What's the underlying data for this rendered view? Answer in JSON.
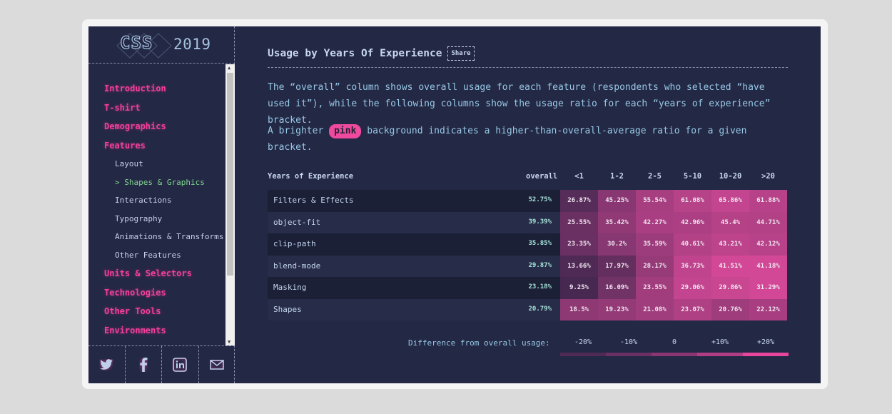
{
  "logo": {
    "mark": "CSS",
    "year": "2019"
  },
  "nav": [
    {
      "label": "Introduction",
      "level": "top"
    },
    {
      "label": "T-shirt",
      "level": "top"
    },
    {
      "label": "Demographics",
      "level": "top"
    },
    {
      "label": "Features",
      "level": "top"
    },
    {
      "label": "Layout",
      "level": "sub"
    },
    {
      "label": "> Shapes & Graphics",
      "level": "sub",
      "active": true
    },
    {
      "label": "Interactions",
      "level": "sub"
    },
    {
      "label": "Typography",
      "level": "sub"
    },
    {
      "label": "Animations & Transforms",
      "level": "sub"
    },
    {
      "label": "Other Features",
      "level": "sub"
    },
    {
      "label": "Units & Selectors",
      "level": "top"
    },
    {
      "label": "Technologies",
      "level": "top"
    },
    {
      "label": "Other Tools",
      "level": "top"
    },
    {
      "label": "Environments",
      "level": "top"
    }
  ],
  "social": [
    "twitter-icon",
    "facebook-icon",
    "linkedin-icon",
    "mail-icon"
  ],
  "section": {
    "title": "Usage by Years Of Experience",
    "share_label": "Share",
    "description_1": "The “overall” column shows overall usage for each feature (respondents who selected “have used it”), while the following columns show the usage ratio for each “years of experience” bracket.",
    "description_2_before": "A brighter",
    "description_2_pill": "pink",
    "description_2_after": "background indicates a higher-than-overall-average ratio for a given bracket."
  },
  "table": {
    "header_feature": "Years of Experience",
    "header_overall": "overall",
    "brackets": [
      "<1",
      "1-2",
      "2-5",
      "5-10",
      "10-20",
      ">20"
    ],
    "rows": [
      {
        "feature": "Filters & Effects",
        "overall": "52.75%",
        "values": [
          "26.87%",
          "45.25%",
          "55.54%",
          "61.08%",
          "65.86%",
          "61.88%"
        ]
      },
      {
        "feature": "object-fit",
        "overall": "39.39%",
        "values": [
          "25.55%",
          "35.42%",
          "42.27%",
          "42.96%",
          "45.4%",
          "44.71%"
        ]
      },
      {
        "feature": "clip-path",
        "overall": "35.85%",
        "values": [
          "23.35%",
          "30.2%",
          "35.59%",
          "40.61%",
          "43.21%",
          "42.12%"
        ]
      },
      {
        "feature": "blend-mode",
        "overall": "29.87%",
        "values": [
          "13.66%",
          "17.97%",
          "28.17%",
          "36.73%",
          "41.51%",
          "41.18%"
        ]
      },
      {
        "feature": "Masking",
        "overall": "23.18%",
        "values": [
          "9.25%",
          "16.09%",
          "23.55%",
          "29.06%",
          "29.86%",
          "31.29%"
        ]
      },
      {
        "feature": "Shapes",
        "overall": "20.79%",
        "values": [
          "18.5%",
          "19.23%",
          "21.08%",
          "23.07%",
          "20.76%",
          "22.12%"
        ]
      }
    ]
  },
  "legend": {
    "label": "Difference from overall usage:",
    "steps": [
      "-20%",
      "-10%",
      "0",
      "+10%",
      "+20%"
    ],
    "colors": [
      "#4f2a55",
      "#6a2f63",
      "#8a3574",
      "#b23d87",
      "#e8459e"
    ]
  },
  "colors": {
    "background": "#232844",
    "accent_pink": "#f23f9b",
    "active_green": "#7fd48f",
    "text_blue": "#97c8e6"
  }
}
